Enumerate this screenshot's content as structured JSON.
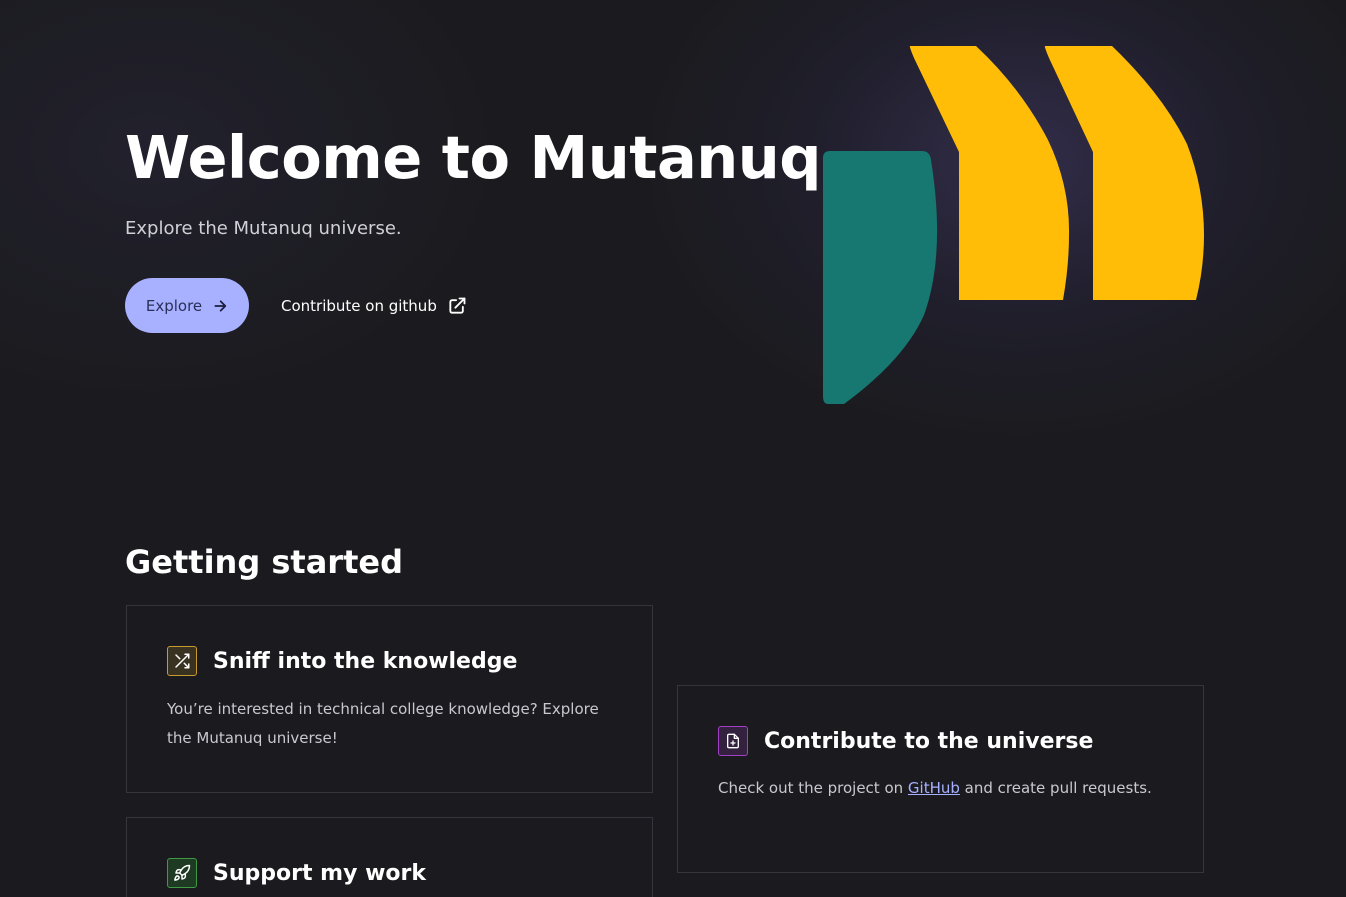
{
  "hero": {
    "title": "Welcome to Mutanuq",
    "tagline": "Explore the Mutanuq universe.",
    "explore_button": "Explore",
    "github_link": "Contribute on github"
  },
  "colors": {
    "background": "#1b1b1f",
    "explore_button_bg": "#a8b1ff",
    "logo_yellow": "#ffbd07",
    "logo_teal": "#167870",
    "link": "#a8b1ff"
  },
  "getting_started": {
    "title": "Getting started",
    "cards": [
      {
        "icon": "shuffle-icon",
        "title": "Sniff into the knowledge",
        "body": "You’re interested in technical college knowledge? Explore the Mutanuq universe!"
      },
      {
        "icon": "file-plus-icon",
        "title": "Contribute to the universe",
        "body_before": "Check out the project on ",
        "body_link": "GitHub",
        "body_after": " and create pull requests."
      },
      {
        "icon": "rocket-icon",
        "title": "Support my work"
      }
    ]
  }
}
